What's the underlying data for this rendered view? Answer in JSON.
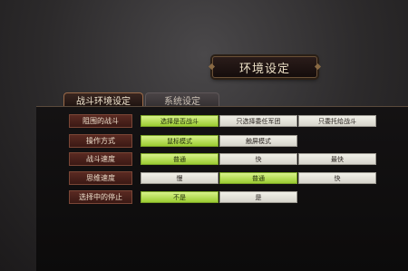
{
  "window": {
    "title": "环境设定"
  },
  "tabs": [
    {
      "label": "战斗环境设定",
      "active": true
    },
    {
      "label": "系统设定",
      "active": false
    }
  ],
  "settings": [
    {
      "label": "阻围的战斗",
      "options": [
        "选择是否战斗",
        "只选择委任军团",
        "只委托给战斗"
      ],
      "selected": 0
    },
    {
      "label": "操作方式",
      "options": [
        "鼠标模式",
        "触屏模式"
      ],
      "selected": 0
    },
    {
      "label": "战斗速度",
      "options": [
        "普通",
        "快",
        "最快"
      ],
      "selected": 0
    },
    {
      "label": "思维速度",
      "options": [
        "慢",
        "普通",
        "快"
      ],
      "selected": 1
    },
    {
      "label": "选择中的停止",
      "options": [
        "不是",
        "是"
      ],
      "selected": 0
    }
  ],
  "colors": {
    "selected": "#b6e04e",
    "unselected": "#e8e6dd",
    "label_bg": "#4a2019"
  }
}
